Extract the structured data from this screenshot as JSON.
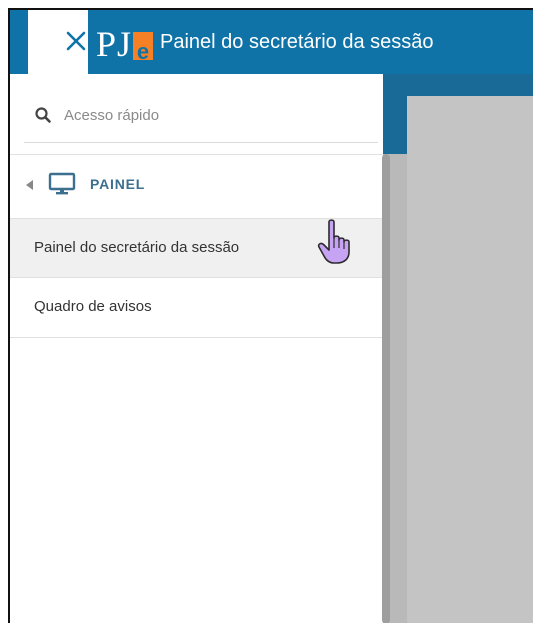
{
  "header": {
    "logo_p": "P",
    "logo_j": "J",
    "logo_e": "e",
    "title": "Painel do secretário da sessão",
    "accent_color": "#0f73a8",
    "logo_orange": "#f58025"
  },
  "sidebar": {
    "search": {
      "placeholder": "Acesso rápido",
      "value": ""
    },
    "section": {
      "label": "PAINEL",
      "icon": "monitor-icon"
    },
    "items": [
      {
        "label": "Painel do secretário da sessão",
        "active": true
      },
      {
        "label": "Quadro de avisos",
        "active": false
      }
    ]
  },
  "cursor": {
    "type": "hand-pointer",
    "color": "#c7a4f3"
  }
}
